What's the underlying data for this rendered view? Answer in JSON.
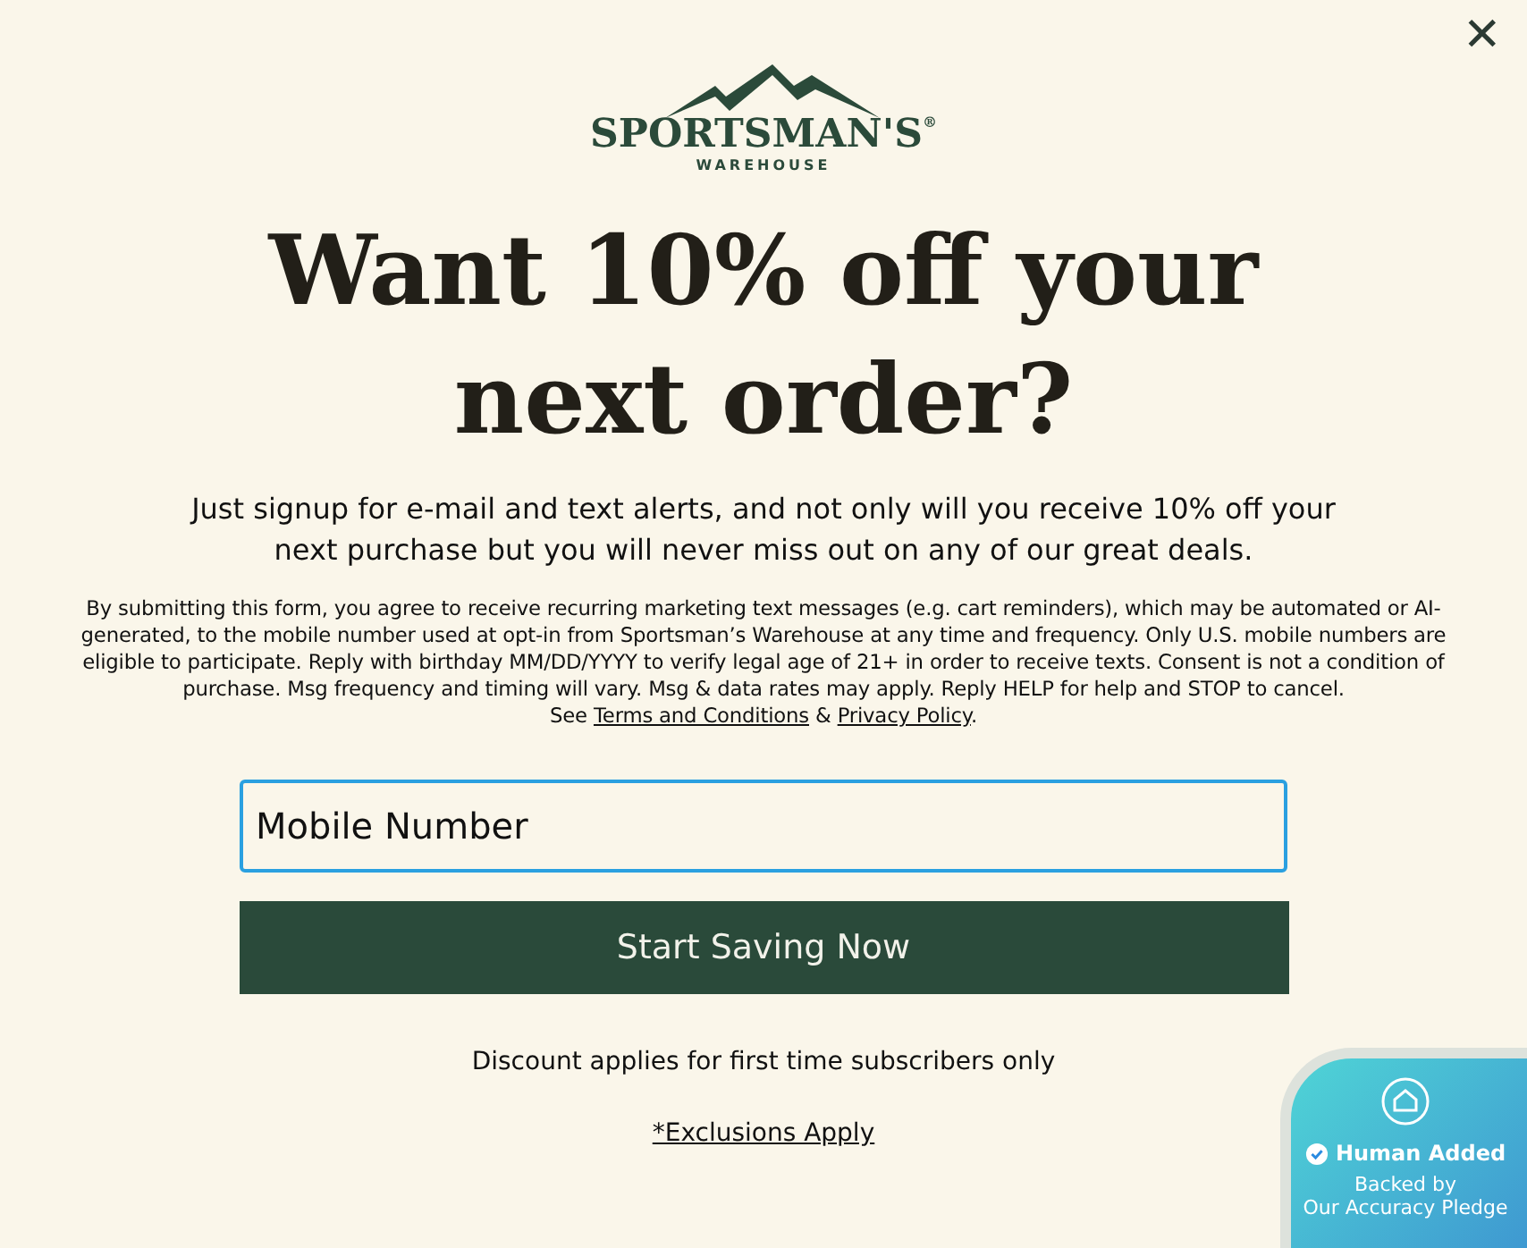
{
  "close": "✕",
  "logo": {
    "name": "SPORTSMAN'S",
    "sub": "WAREHOUSE",
    "mark": "®"
  },
  "headline": "Want 10% off your next order?",
  "intro": "Just signup for e-mail and text alerts, and not only will you receive 10% off your next purchase but you will never miss out on any of our great deals.",
  "legal": {
    "text": "By submitting this form, you agree to receive recurring marketing text messages (e.g. cart reminders), which may be automated or AI-generated, to the mobile number used at opt-in from Sportsman’s Warehouse at any time and frequency. Only U.S. mobile numbers are eligible to participate. Reply with birthday MM/DD/YYYY to verify legal age of 21+ in order to receive texts. Consent is not a condition of purchase. Msg frequency and timing will vary. Msg & data rates may apply. Reply HELP for help and STOP to cancel.",
    "see": "See",
    "links": [
      "Terms and Conditions",
      "Privacy Policy"
    ],
    "joiner": "&",
    "end": "."
  },
  "phone_field": {
    "placeholder": "Mobile Number"
  },
  "submit": "Start Saving Now",
  "note": "Discount applies for first time subscribers only",
  "exclusions": "*Exclusions Apply",
  "badge": {
    "title": "Human Added",
    "line1": "Backed by",
    "line2": "Our Accuracy Pledge"
  }
}
